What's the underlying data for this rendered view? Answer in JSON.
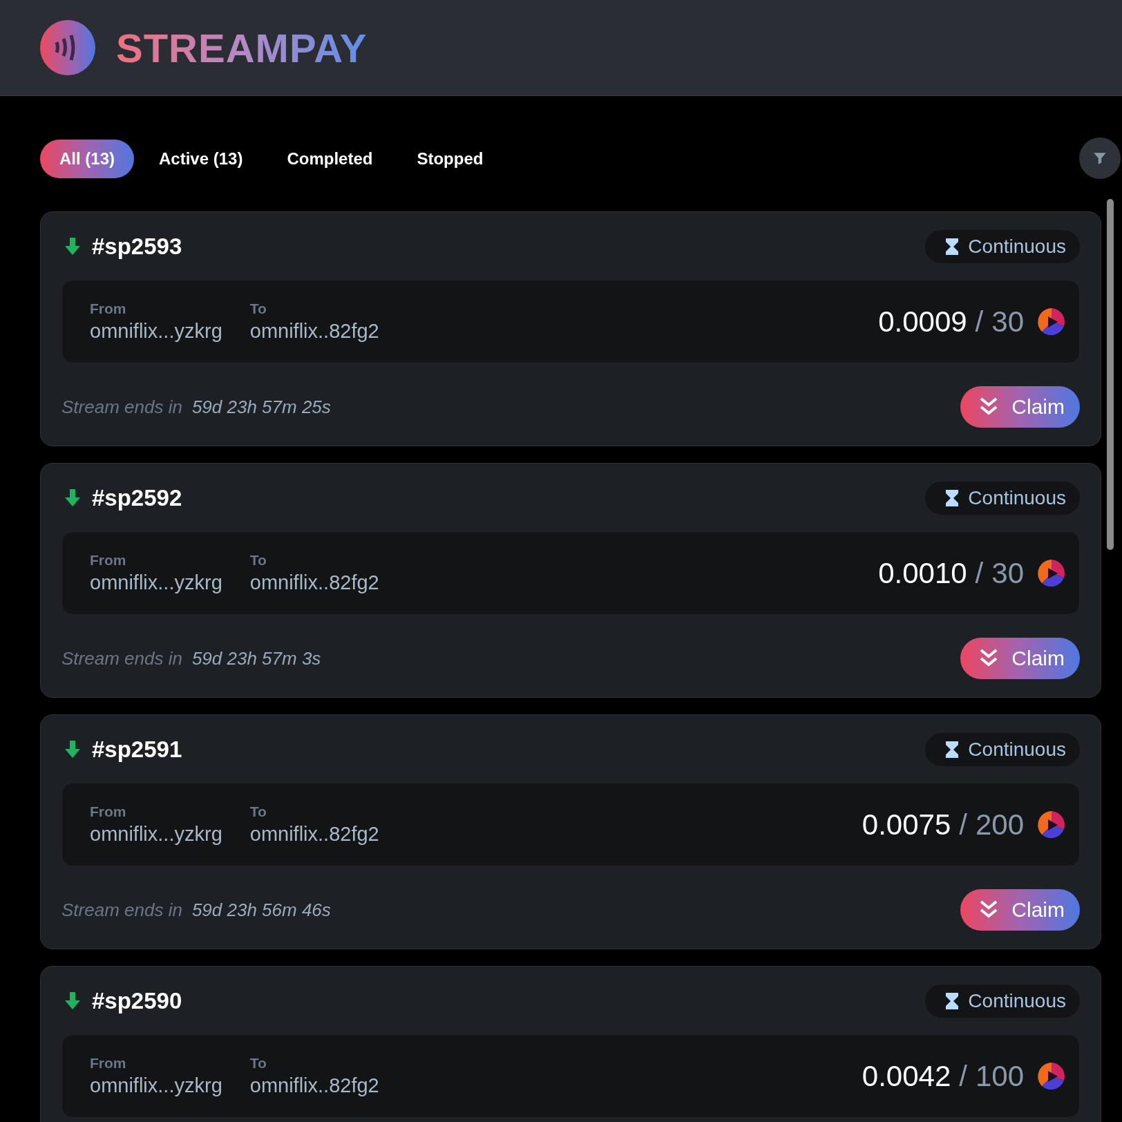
{
  "header": {
    "brand": "STREAMPAY"
  },
  "tabs": [
    {
      "label": "All (13)",
      "selected": true
    },
    {
      "label": "Active (13)",
      "selected": false
    },
    {
      "label": "Completed",
      "selected": false
    },
    {
      "label": "Stopped",
      "selected": false
    }
  ],
  "streams": [
    {
      "id": "#sp2593",
      "type": "Continuous",
      "from_label": "From",
      "from": "omniflix...yzkrg",
      "to_label": "To",
      "to": "omniflix..82fg2",
      "streamed": "0.0009",
      "separator": "/",
      "total": "30",
      "ends_label": "Stream ends in",
      "ends_in": "59d 23h 57m 25s",
      "action": "Claim"
    },
    {
      "id": "#sp2592",
      "type": "Continuous",
      "from_label": "From",
      "from": "omniflix...yzkrg",
      "to_label": "To",
      "to": "omniflix..82fg2",
      "streamed": "0.0010",
      "separator": "/",
      "total": "30",
      "ends_label": "Stream ends in",
      "ends_in": "59d 23h 57m 3s",
      "action": "Claim"
    },
    {
      "id": "#sp2591",
      "type": "Continuous",
      "from_label": "From",
      "from": "omniflix...yzkrg",
      "to_label": "To",
      "to": "omniflix..82fg2",
      "streamed": "0.0075",
      "separator": "/",
      "total": "200",
      "ends_label": "Stream ends in",
      "ends_in": "59d 23h 56m 46s",
      "action": "Claim"
    },
    {
      "id": "#sp2590",
      "type": "Continuous",
      "from_label": "From",
      "from": "omniflix...yzkrg",
      "to_label": "To",
      "to": "omniflix..82fg2",
      "streamed": "0.0042",
      "separator": "/",
      "total": "100"
    }
  ]
}
